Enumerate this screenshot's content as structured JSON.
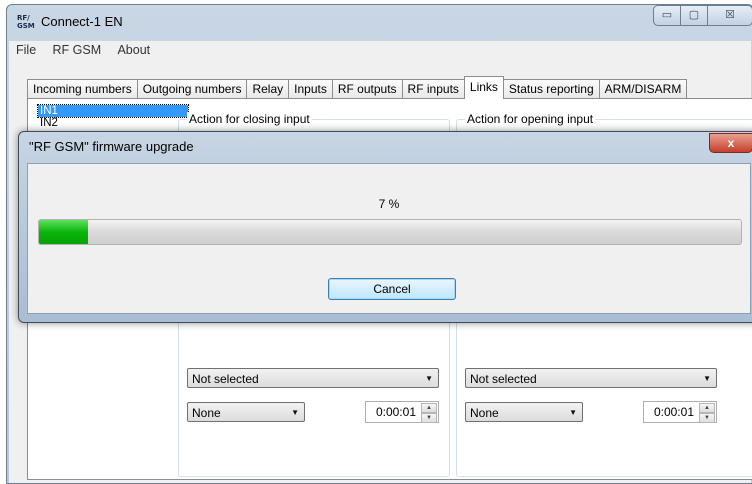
{
  "window": {
    "title": "Connect-1 EN",
    "icon_text": "RF/\nGSM"
  },
  "caption": {
    "minimize": "▭",
    "maximize": "☐",
    "close": "☒"
  },
  "menu": [
    "File",
    "RF GSM",
    "About"
  ],
  "tabs": [
    {
      "label": "Incoming numbers",
      "active": false
    },
    {
      "label": "Outgoing numbers",
      "active": false
    },
    {
      "label": "Relay",
      "active": false
    },
    {
      "label": "Inputs",
      "active": false
    },
    {
      "label": "RF outputs",
      "active": false
    },
    {
      "label": "RF inputs",
      "active": false
    },
    {
      "label": "Links",
      "active": true
    },
    {
      "label": "Status reporting",
      "active": false
    },
    {
      "label": "ARM/DISARM",
      "active": false
    }
  ],
  "inputs_list": [
    "IN1",
    "IN2"
  ],
  "closing": {
    "label": "Action for closing input",
    "action": "Not selected",
    "mode": "None",
    "time": "0:00:01"
  },
  "opening": {
    "label": "Action for opening input",
    "action": "Not selected",
    "mode": "None",
    "time": "0:00:01"
  },
  "dialog": {
    "title": "\"RF GSM\" firmware upgrade",
    "close": "x",
    "progress_percent": 7,
    "progress_text": "7 %",
    "cancel_label": "Cancel"
  }
}
